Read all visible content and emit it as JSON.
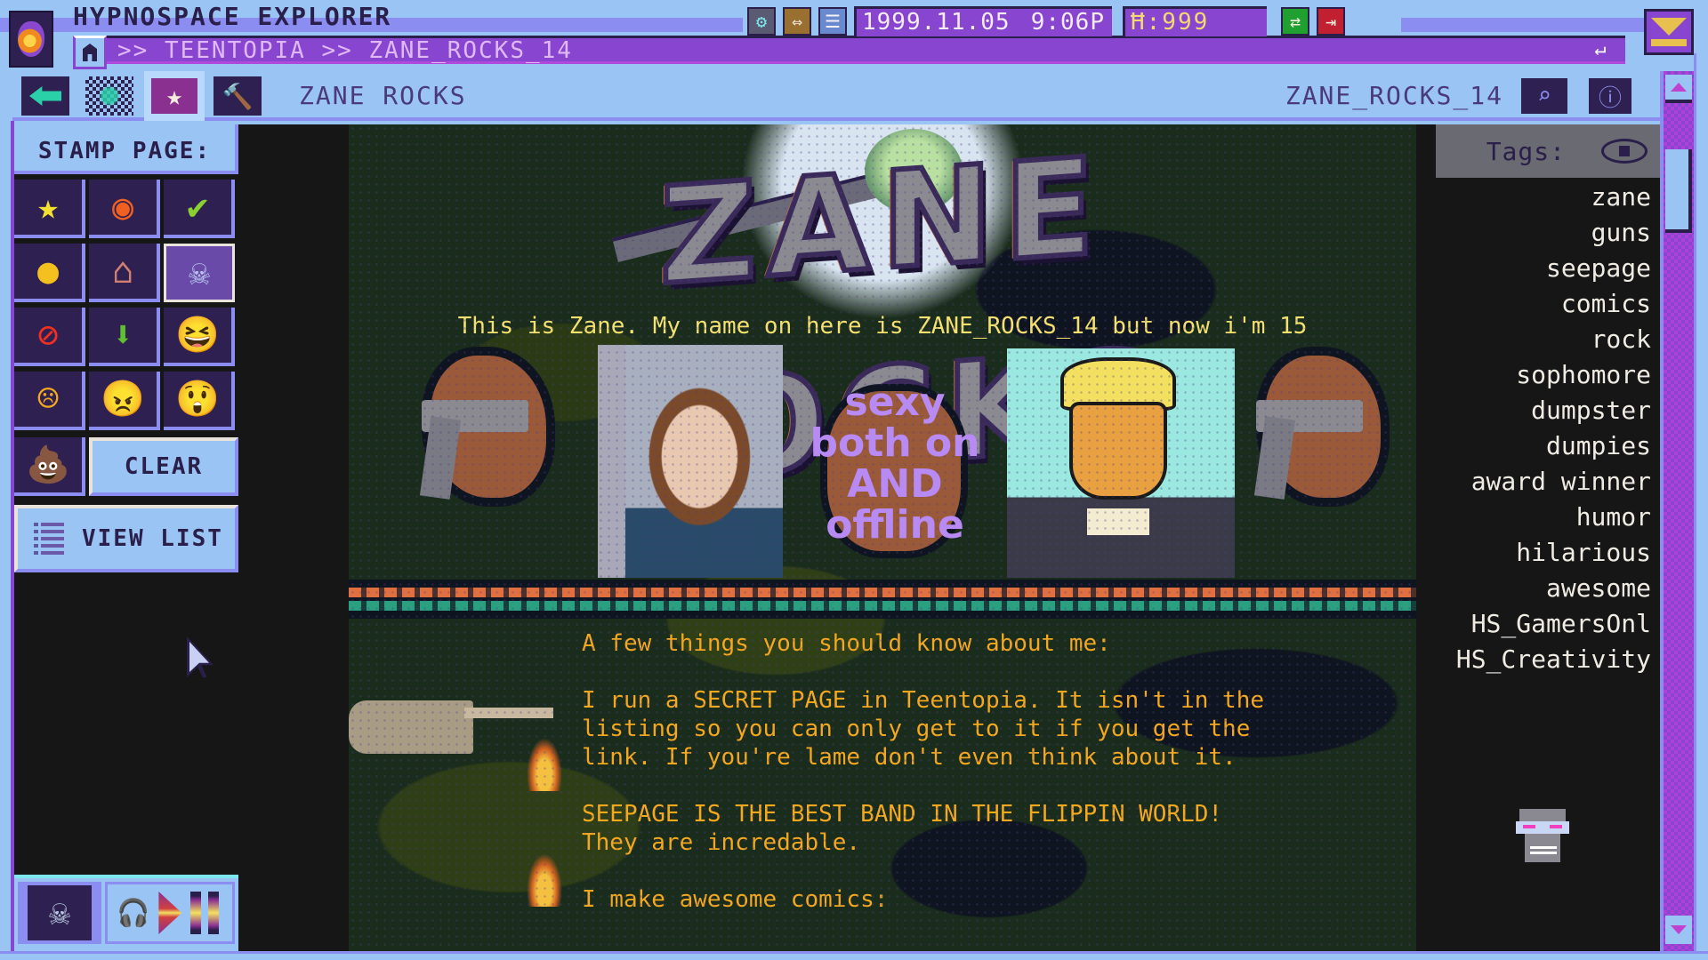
{
  "window": {
    "app_title": "HYPNOSPACE EXPLORER",
    "address": ">> TEENTOPIA >> ZANE_ROCKS_14",
    "go_icon": "↵"
  },
  "tray": {
    "settings_icon": "⚙",
    "transfer_icon": "⇔",
    "menu_icon": "☰",
    "date": "1999.11.05",
    "time": "9:06P",
    "hypnocoin": "Ħ:999",
    "network_icon": "⇄",
    "logout_icon": "⇥"
  },
  "toolbar": {
    "stamp_icon": "★",
    "gavel_icon": "🔨",
    "page_title": "ZANE ROCKS",
    "page_id": "ZANE_ROCKS_14",
    "search_icon": "⌕",
    "info_icon": "ⓘ"
  },
  "stamp_panel": {
    "header": "STAMP PAGE:",
    "stamps": [
      {
        "name": "star",
        "glyph": "★",
        "color": "#f4e030"
      },
      {
        "name": "eye",
        "glyph": "◉",
        "color": "#f06020"
      },
      {
        "name": "check",
        "glyph": "✔",
        "color": "#8ad030"
      },
      {
        "name": "coin",
        "glyph": "●",
        "color": "#f4c020"
      },
      {
        "name": "house",
        "glyph": "⌂",
        "color": "#d08070"
      },
      {
        "name": "skull",
        "glyph": "☠",
        "color": "#b8c8f0",
        "selected": true
      },
      {
        "name": "no",
        "glyph": "⊘",
        "color": "#f03020"
      },
      {
        "name": "down-arrow",
        "glyph": "⬇",
        "color": "#60c030"
      },
      {
        "name": "laughing-face",
        "glyph": "😆",
        "color": "#f4a820"
      },
      {
        "name": "sad-face",
        "glyph": "☹",
        "color": "#f4a820"
      },
      {
        "name": "angry-face",
        "glyph": "😠",
        "color": "#f4a820"
      },
      {
        "name": "shocked-face",
        "glyph": "😲",
        "color": "#f4a820"
      }
    ],
    "poop_stamp": {
      "name": "poop",
      "glyph": "💩",
      "color": "#d08a40"
    },
    "clear_label": "CLEAR",
    "view_list_label": "VIEW LIST"
  },
  "player": {
    "skull_icon": "☠",
    "headphones_icon": "🎧"
  },
  "page": {
    "banner_title": "ZANE ROCKS",
    "intro": "This is Zane. My name on here is ZANE_ROCKS_14 but now i'm 15",
    "slogan": [
      "sexy",
      "both on",
      "AND",
      "offline"
    ],
    "paragraphs": [
      "A few things you should know about me:",
      "I run a SECRET PAGE in Teentopia. It isn't in the\nlisting so you can only get to it if you get the\nlink. If you're lame don't even think about it.",
      "SEEPAGE IS THE BEST BAND IN THE FLIPPIN WORLD!\nThey are incredable.",
      "I make awesome comics:"
    ]
  },
  "tags": {
    "label": "Tags:",
    "items": [
      "zane",
      "guns",
      "seepage",
      "comics",
      "rock",
      "sophomore",
      "dumpster",
      "dumpies",
      "award winner",
      "humor",
      "hilarious",
      "awesome",
      "HS_GamersOnl",
      "HS_Creativity"
    ]
  },
  "colors": {
    "frame": "#9ac4f4",
    "accent_purple": "#8745d0",
    "text_yellow": "#f4e070",
    "text_orange": "#f4a820"
  }
}
